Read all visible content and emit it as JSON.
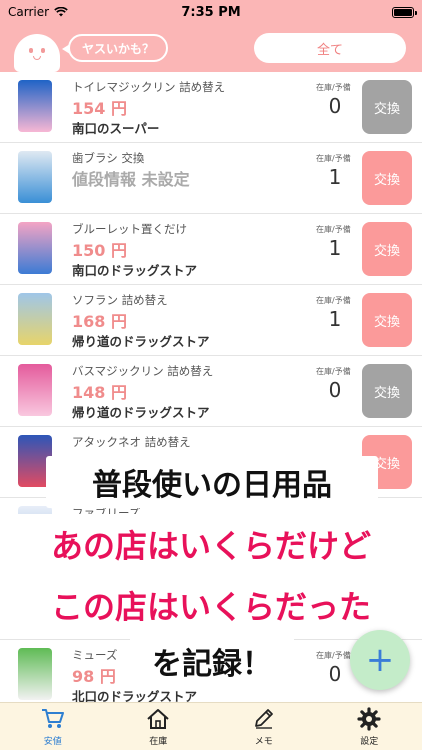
{
  "status_bar": {
    "carrier": "Carrier",
    "time": "7:35 PM"
  },
  "header": {
    "bubble_text": "ヤスいかも？",
    "filter_label": "全て"
  },
  "stock_label": "在庫/予備",
  "items": [
    {
      "name": "トイレマジックリン 詰め替え",
      "price": "154 円",
      "store": "南口のスーパー",
      "count": "0",
      "button": "交換",
      "button_color": "#a3a3a3",
      "price_unset": false,
      "colors": [
        "#1f63c6",
        "#f7b7d4"
      ]
    },
    {
      "name": "歯ブラシ 交換",
      "price": "値段情報 未設定",
      "store": "",
      "count": "1",
      "button": "交換",
      "button_color": "#fb9a9a",
      "price_unset": true,
      "colors": [
        "#dfe9f2",
        "#3a8fd6"
      ]
    },
    {
      "name": "ブルーレット置くだけ",
      "price": "150 円",
      "store": "南口のドラッグストア",
      "count": "1",
      "button": "交換",
      "button_color": "#fb9a9a",
      "price_unset": false,
      "colors": [
        "#f4a4c4",
        "#3c7bd4"
      ]
    },
    {
      "name": "ソフラン 詰め替え",
      "price": "168 円",
      "store": "帰り道のドラッグストア",
      "count": "1",
      "button": "交換",
      "button_color": "#fb9a9a",
      "price_unset": false,
      "colors": [
        "#9fc6e8",
        "#e7d46a"
      ]
    },
    {
      "name": "バスマジックリン 詰め替え",
      "price": "148 円",
      "store": "帰り道のドラッグストア",
      "count": "0",
      "button": "交換",
      "button_color": "#a3a3a3",
      "price_unset": false,
      "colors": [
        "#e45b9c",
        "#f9c8df"
      ]
    },
    {
      "name": "アタックネオ 詰め替え",
      "price": "",
      "store": "",
      "count": "",
      "button": "交換",
      "button_color": "#fb9a9a",
      "price_unset": false,
      "colors": [
        "#2d56b8",
        "#e24b62"
      ]
    },
    {
      "name": "ファブリーズ",
      "price": "",
      "store": "",
      "count": "",
      "button": "",
      "button_color": "#fb9a9a",
      "price_unset": false,
      "colors": [
        "#e8eef8",
        "#92b4e0"
      ]
    },
    {
      "name": "",
      "price": "",
      "store": "北口のドラッグストア",
      "count": "",
      "button": "",
      "button_color": "#fb9a9a",
      "price_unset": false,
      "colors": [
        "#6cbd70",
        "#ffffff"
      ]
    },
    {
      "name": "ミューズ",
      "price": "98 円",
      "store": "北口のドラッグストア",
      "count": "0",
      "button": "",
      "button_color": "#fb9a9a",
      "price_unset": false,
      "colors": [
        "#5fbb55",
        "#f2f2f2"
      ]
    }
  ],
  "overlay": {
    "line1": "普段使いの日用品",
    "line2": "あの店はいくらだけど",
    "line3": "この店はいくらだった",
    "line4": "を記録！"
  },
  "fab_label": "+",
  "tabs": [
    {
      "label": "安値",
      "icon": "cart-icon",
      "active": true
    },
    {
      "label": "在庫",
      "icon": "house-icon",
      "active": false
    },
    {
      "label": "メモ",
      "icon": "pencil-icon",
      "active": false
    },
    {
      "label": "設定",
      "icon": "gear-icon",
      "active": false
    }
  ],
  "theme": {
    "header_pink": "#fbb6b6",
    "price_pink": "#f08c8c",
    "accent_red": "#e8115a",
    "tab_active": "#2f7fd1",
    "tab_bg": "#fdf5e1"
  }
}
